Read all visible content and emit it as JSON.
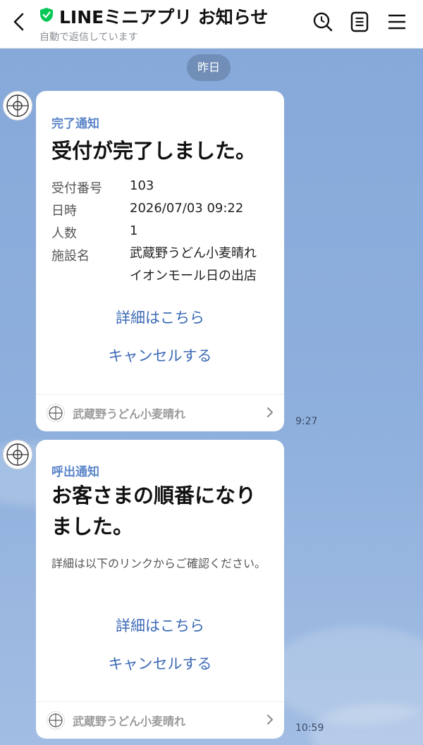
{
  "header": {
    "title": "LINEミニアプリ お知らせ",
    "subtitle": "自動で返信しています",
    "icons": [
      "back-arrow-icon",
      "verified-shield-icon",
      "search-icon",
      "notes-icon",
      "menu-icon"
    ]
  },
  "date_separator": "昨日",
  "messages": [
    {
      "kicker": "完了通知",
      "headline": "受付が完了しました。",
      "rows": [
        {
          "label": "受付番号",
          "value": "103"
        },
        {
          "label": "日時",
          "value": "2026/07/03 09:22"
        },
        {
          "label": "人数",
          "value": "1"
        },
        {
          "label": "施設名",
          "value": "武蔵野うどん小麦晴れ イオンモール日の出店"
        }
      ],
      "link_detail": "詳細はこちら",
      "link_cancel": "キャンセルする",
      "footer_name": "武蔵野うどん小麦晴れ",
      "time": "9:27"
    },
    {
      "kicker": "呼出通知",
      "headline": "お客さまの順番になりました。",
      "description": "詳細は以下のリンクからご確認ください。",
      "link_detail": "詳細はこちら",
      "link_cancel": "キャンセルする",
      "footer_name": "武蔵野うどん小麦晴れ",
      "time": "10:59"
    }
  ],
  "colors": {
    "accent": "#5b85c9",
    "link": "#3c6ab5",
    "background": "#8eaedb",
    "verified": "#06c755"
  }
}
